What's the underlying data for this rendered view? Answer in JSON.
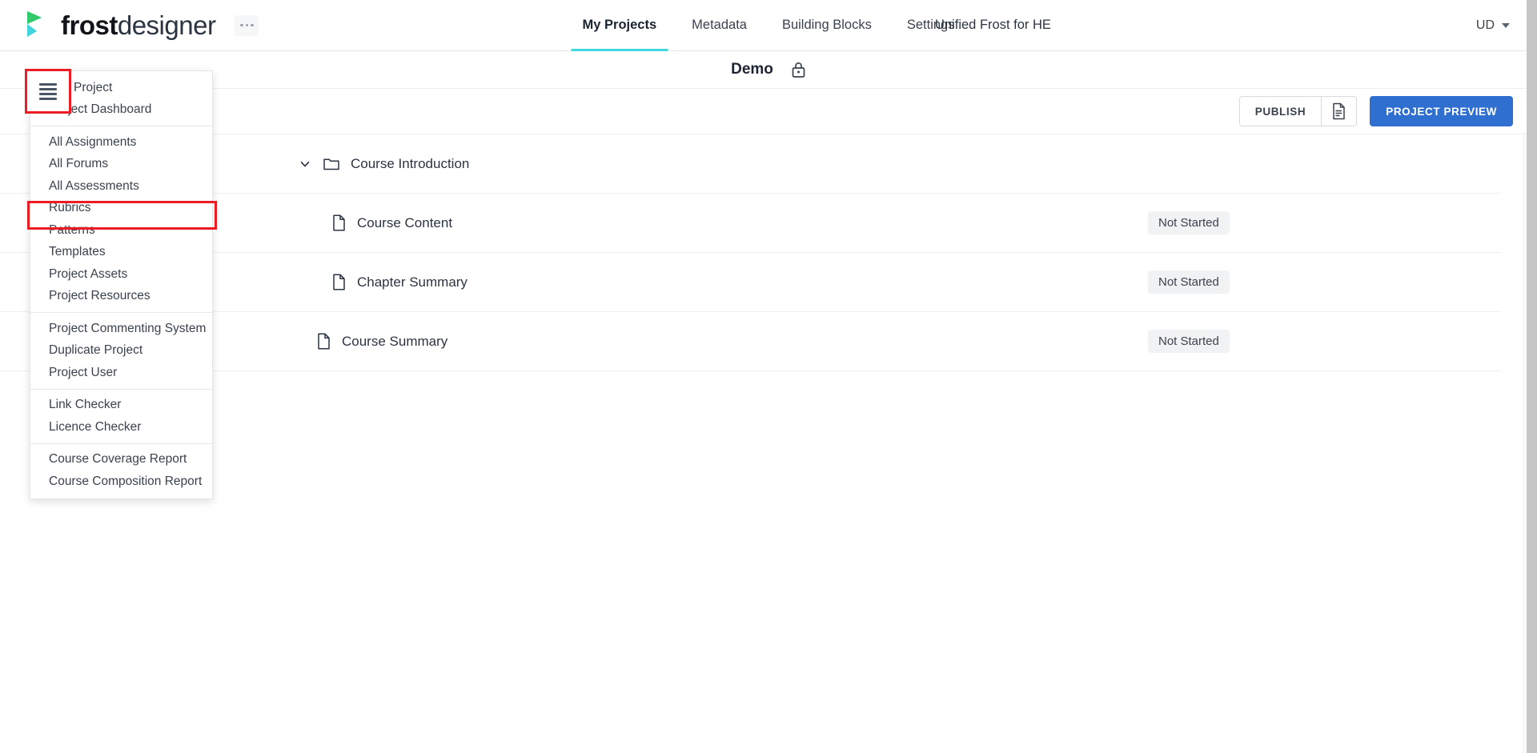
{
  "header": {
    "brand_bold": "frost",
    "brand_light": "designer",
    "kebab_icon": "kebab-menu-icon",
    "nav": [
      {
        "label": "My Projects",
        "active": true
      },
      {
        "label": "Metadata",
        "active": false
      },
      {
        "label": "Building Blocks",
        "active": false
      },
      {
        "label": "Settings",
        "active": false
      }
    ],
    "org_name": "Unified Frost for HE",
    "user_initials": "UD",
    "accent_underline": "#3fd8e0"
  },
  "project_bar": {
    "title": "Demo",
    "lock_icon": "lock-icon"
  },
  "toolbar": {
    "hamburger_icon": "hamburger-icon",
    "publish_label": "PUBLISH",
    "document_icon": "document-icon",
    "preview_label": "PROJECT PREVIEW",
    "preview_color": "#2f6fd0",
    "highlight_color": "#ec1c24"
  },
  "menu": {
    "groups": [
      {
        "items": [
          "Edit Project",
          "Project Dashboard"
        ]
      },
      {
        "items": [
          "All Assignments",
          "All Forums",
          "All Assessments",
          "Rubrics",
          "Patterns",
          "Templates",
          "Project Assets",
          "Project Resources"
        ]
      },
      {
        "items": [
          "Project Commenting System",
          "Duplicate Project",
          "Project User"
        ]
      },
      {
        "items": [
          "Link Checker",
          "Licence Checker"
        ]
      },
      {
        "items": [
          "Course Coverage Report",
          "Course Composition Report"
        ]
      }
    ],
    "highlighted_item": "All Assessments"
  },
  "tree": {
    "rows": [
      {
        "label": "Course Introduction",
        "icon": "folder-icon",
        "indent": "folder",
        "expanded": true,
        "status": null
      },
      {
        "label": "Course Content",
        "icon": "document-icon",
        "indent": "child",
        "status": "Not Started"
      },
      {
        "label": "Chapter Summary",
        "icon": "document-icon",
        "indent": "child",
        "status": "Not Started"
      },
      {
        "label": "Course Summary",
        "icon": "document-icon",
        "indent": "top",
        "status": "Not Started"
      }
    ]
  }
}
